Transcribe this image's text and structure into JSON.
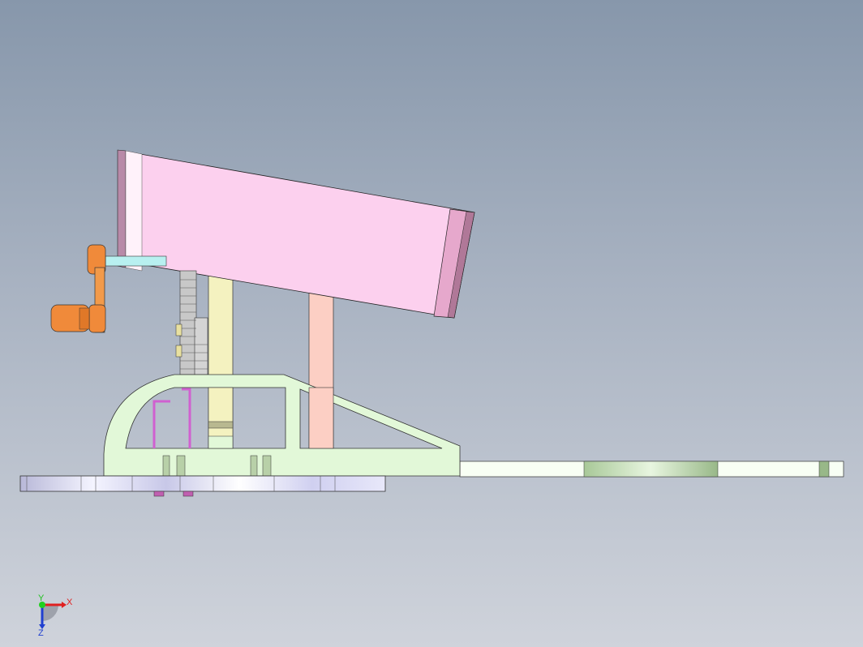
{
  "viewport": {
    "background_top": "#8797ab",
    "background_bottom": "#cfd3db"
  },
  "triad": {
    "x_label": "X",
    "y_label": "Y",
    "z_label": "Z",
    "x_color": "#e02020",
    "y_color": "#20d020",
    "z_color": "#2040d0"
  },
  "model_colors": {
    "hopper": "#fcd0ee",
    "frame": "#e2f8d8",
    "crank": "#f08a3a",
    "base": "#d8d8f0",
    "post_pink": "#fccfc4",
    "post_yellow": "#f4f2c0"
  }
}
